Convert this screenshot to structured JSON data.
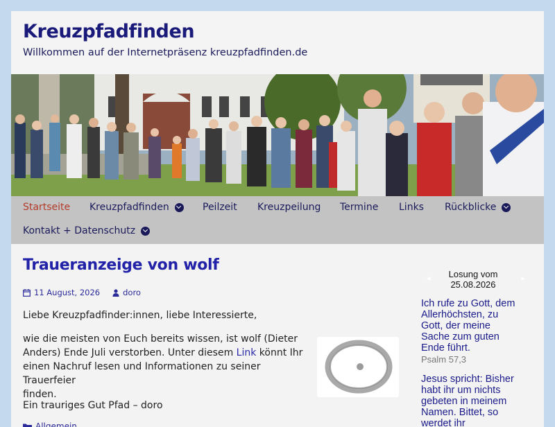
{
  "site": {
    "title": "Kreuzpfadfinden",
    "tagline": "Willkommen auf der Internetpräsenz kreuzpfadfinden.de"
  },
  "hero": {
    "icon": "group-photo-image"
  },
  "nav": {
    "items": [
      {
        "label": "Startseite",
        "active": true,
        "submenu": false
      },
      {
        "label": "Kreuzpfadfinden",
        "active": false,
        "submenu": true
      },
      {
        "label": "Peilzeit",
        "active": false,
        "submenu": false
      },
      {
        "label": "Kreuzpeilung",
        "active": false,
        "submenu": false
      },
      {
        "label": "Termine",
        "active": false,
        "submenu": false
      },
      {
        "label": "Links",
        "active": false,
        "submenu": false
      },
      {
        "label": "Rückblicke",
        "active": false,
        "submenu": true
      },
      {
        "label": "Kontakt + Datenschutz",
        "active": false,
        "submenu": true
      }
    ]
  },
  "post": {
    "title": "Traueranzeige von wolf",
    "date": "11 August, 2026",
    "author": "doro",
    "greeting": "Liebe Kreuzpfadfinder:innen, liebe Interessierte,",
    "body_line1": "wie die meisten von Euch bereits wissen, ist wolf (Dieter",
    "body_line2_before": "Anders) Ende Juli verstorben. Unter diesem ",
    "body_link": "Link",
    "body_line2_after": " könnt Ihr",
    "body_line3": "einen Nachruf lesen und Informationen zu seiner Trauerfeier",
    "body_line4": "finden.",
    "closing": "Ein trauriges Gut Pfad – doro",
    "category": "Allgemein"
  },
  "sidebar": {
    "losung_heading_line1": "Losung vom",
    "losung_heading_line2": "25.08.2026",
    "losung_prev": "◂",
    "losung_next": "▸",
    "verse1_lines": [
      "Ich rufe zu Gott, dem",
      "Allerhöchsten, zu",
      "Gott, der meine",
      "Sache zum guten",
      "Ende führt."
    ],
    "verse1_ref": "Psalm 57,3",
    "verse2_lines": [
      "Jesus spricht: Bisher",
      "habt ihr um nichts",
      "gebeten in meinem",
      "Namen. Bittet, so",
      "werdet ihr"
    ]
  },
  "colors": {
    "background": "#c5d9ee",
    "title": "#1a1a7a",
    "link": "#2a2aa8",
    "nav_bg": "#c3c3c3",
    "nav_active": "#b33a2a"
  }
}
